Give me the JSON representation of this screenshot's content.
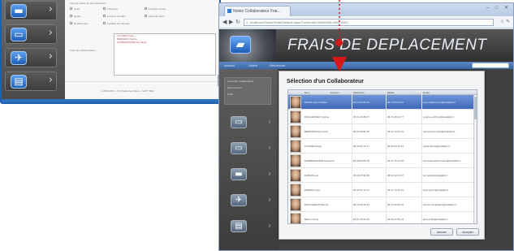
{
  "back_window": {
    "section_label": "Type de saisie de frais autorisées",
    "options": [
      "Hotel",
      "Transport",
      "Location voiture",
      "Repas",
      "Location de salle",
      "Achat de livres",
      "Deplacement",
      "Location de vehicule"
    ],
    "list_label": "Liste des collaborateurs",
    "list_items": [
      "LACORE Paule",
      "BERNERO Nadine",
      "DARBIERMARIE Fernande"
    ],
    "footer_text": "© 2009-2010 - ITC Vallée des Mines - SOFT DEV"
  },
  "browser": {
    "tab_title": "Notes Collaborateur Frai...",
    "window_buttons": "– □ ✕",
    "url": "localhost/ScreenFrais/Default.aspx?ScreenId=00000000-0000-0000",
    "nav_back": "◀",
    "nav_forward": "▶",
    "nav_reload": "↻",
    "tools": "☆ ✎"
  },
  "app": {
    "banner_title": "FRAIS DE DEPLACEMENT",
    "car_icon": "🚗",
    "subnav": [
      "Accueil",
      "Saisie",
      "Recherche"
    ],
    "side_panel_lines": [
      "Connecté: Collaborateur",
      "Déconnexion",
      "Profil"
    ],
    "icons": [
      {
        "name": "folder-icon",
        "glyph": "▭"
      },
      {
        "name": "car-icon",
        "glyph": "▭"
      },
      {
        "name": "hotel-icon",
        "glyph": "▬"
      },
      {
        "name": "plane-icon",
        "glyph": "✈"
      },
      {
        "name": "book-icon",
        "glyph": "▤"
      }
    ]
  },
  "dialog": {
    "title": "Sélection d'un Collaborateur",
    "columns": [
      "Nom",
      "Prenom",
      "Telephone",
      "Mobile",
      "Email"
    ],
    "rows": [
      {
        "name": "ROSSI Jean Charles",
        "phone": "06 12 61 81 03",
        "mobile": "06 13 54 04 12",
        "email": "jean-charles.rossi@scalable.fr"
      },
      {
        "name": "ROCHEFORD Virginie",
        "phone": "05 34 29 88 27",
        "mobile": "06 16 26 33 77",
        "email": "virginie.rochford@scalable.fr"
      },
      {
        "name": "BERNARD Raymond",
        "phone": "05 26 69 82 96",
        "mobile": "06 42 73 21 46",
        "email": "raymond.bernard@scalable.fr"
      },
      {
        "name": "LACORE Paule",
        "phone": "05 18 02 79 17",
        "mobile": "06 93 04 31 53",
        "email": "paule.lacore@scalable.fr"
      },
      {
        "name": "DARBIERMARIE Fernande",
        "phone": "05 99 83 05 35",
        "mobile": "06 37 75 17 40",
        "email": "fernande.darbiermarie@scalable.fr"
      },
      {
        "name": "DUBOIS Luc",
        "phone": "05 18 05 96 80",
        "mobile": "06 52 63 91 57",
        "email": "luc.dubois@scalable.fr"
      },
      {
        "name": "PERRIN Louis",
        "phone": "05 42 97 12 27",
        "mobile": "06 37 70 30 32",
        "email": "louis.perrin@scalable.fr"
      },
      {
        "name": "MOULINEAUX Benoit",
        "phone": "05 18 50 40 10",
        "mobile": "06 67 05 49 15",
        "email": "benoit.moulineaux@scalable.fr"
      },
      {
        "name": "BELLO Anne",
        "phone": "05 60 79 00 92",
        "mobile": "06 06 27 95 13",
        "email": "anne.bello@scalable.fr"
      },
      {
        "name": "GIRAUD Louis",
        "phone": "05 16 83 02 08",
        "mobile": "06 92 07 08 93",
        "email": "louis.giraud@scalable.fr"
      }
    ],
    "button_cancel": "Annuler",
    "button_ok": "Accepter"
  },
  "colors": {
    "accent": "#1f5fb0",
    "selected_row": "#4a74c0",
    "annotation": "#d81818"
  }
}
